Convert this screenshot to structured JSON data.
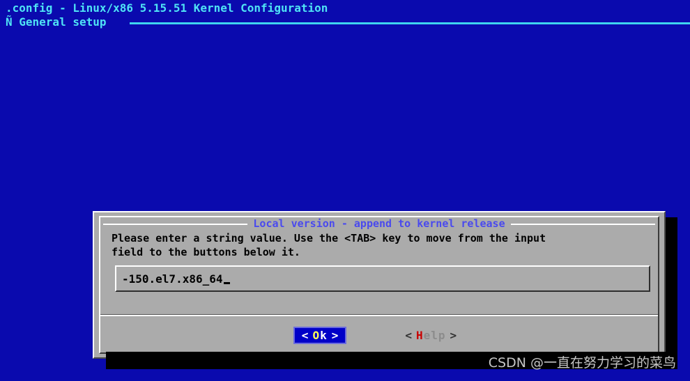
{
  "header": {
    "app_title": ".config - Linux/x86 5.15.51 Kernel Configuration",
    "menu_path": "Ñ General setup"
  },
  "dialog": {
    "title": "Local version - append to kernel release",
    "prompt": "Please enter a string value. Use the <TAB> key to move from the input\nfield to the buttons below it.",
    "input": {
      "value": "-150.el7.x86_64",
      "placeholder": ""
    },
    "buttons": [
      {
        "left_arrow": "<",
        "hotkey": "O",
        "rest": "k",
        "right_arrow": ">",
        "selected": true
      },
      {
        "left_arrow": "<",
        "hotkey": "H",
        "rest": "elp",
        "right_arrow": ">",
        "selected": false
      }
    ]
  },
  "watermark": {
    "text": "CSDN @一直在努力学习的菜鸟"
  },
  "colors": {
    "background_blue": "#0a0aae",
    "header_cyan": "#4fe3f5",
    "dialog_gray": "#ababab",
    "dialog_title_blue": "#4a4aee",
    "selected_button_bg": "#0000c8",
    "hotkey_yellow": "#ffff55",
    "hotkey_red": "#c90000",
    "shadow_black": "#000000"
  }
}
